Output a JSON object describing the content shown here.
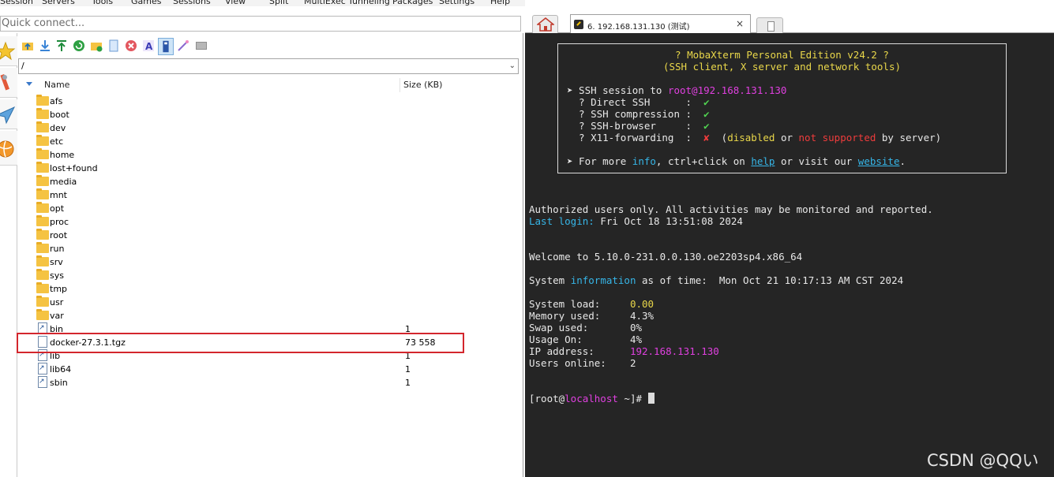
{
  "menubar": {
    "items": [
      "Session",
      "Servers",
      "Tools",
      "Games",
      "Sessions",
      "View",
      "Split",
      "MultiExec",
      "Tunneling",
      "Packages",
      "Settings",
      "Help"
    ]
  },
  "quick_connect": {
    "placeholder": "Quick connect..."
  },
  "sftp": {
    "path": "/",
    "columns": {
      "name": "Name",
      "size": "Size (KB)"
    },
    "files": [
      {
        "name": "afs",
        "type": "folder",
        "size": ""
      },
      {
        "name": "boot",
        "type": "folder",
        "size": ""
      },
      {
        "name": "dev",
        "type": "folder",
        "size": ""
      },
      {
        "name": "etc",
        "type": "folder",
        "size": ""
      },
      {
        "name": "home",
        "type": "folder",
        "size": ""
      },
      {
        "name": "lost+found",
        "type": "folder",
        "size": ""
      },
      {
        "name": "media",
        "type": "folder",
        "size": ""
      },
      {
        "name": "mnt",
        "type": "folder",
        "size": ""
      },
      {
        "name": "opt",
        "type": "folder",
        "size": ""
      },
      {
        "name": "proc",
        "type": "folder",
        "size": ""
      },
      {
        "name": "root",
        "type": "folder",
        "size": ""
      },
      {
        "name": "run",
        "type": "folder",
        "size": ""
      },
      {
        "name": "srv",
        "type": "folder",
        "size": ""
      },
      {
        "name": "sys",
        "type": "folder",
        "size": ""
      },
      {
        "name": "tmp",
        "type": "folder",
        "size": ""
      },
      {
        "name": "usr",
        "type": "folder",
        "size": ""
      },
      {
        "name": "var",
        "type": "folder",
        "size": ""
      },
      {
        "name": "bin",
        "type": "link",
        "size": "1"
      },
      {
        "name": "docker-27.3.1.tgz",
        "type": "file",
        "size": "73 558"
      },
      {
        "name": "lib",
        "type": "link",
        "size": "1"
      },
      {
        "name": "lib64",
        "type": "link",
        "size": "1"
      },
      {
        "name": "sbin",
        "type": "link",
        "size": "1"
      }
    ],
    "highlight_color": "#d3262d"
  },
  "tabs": {
    "session_label": "6. 192.168.131.130 (测试)",
    "close": "×"
  },
  "terminal": {
    "banner": {
      "title": "? MobaXterm Personal Edition v24.2 ?",
      "subtitle": "(SSH client, X server and network tools)",
      "session_prefix": "➤ SSH session to ",
      "session_target": "root@192.168.131.130",
      "direct_ssh": "  ? Direct SSH      :  ",
      "compression": "  ? SSH compression :  ",
      "browser": "  ? SSH-browser     :  ",
      "x11": "  ? X11-forwarding  :  ",
      "check": "✔",
      "cross": "✘",
      "x11_note_1": "  (",
      "x11_disabled": "disabled",
      "x11_or": " or ",
      "x11_not_supported": "not supported",
      "x11_note_2": " by server)",
      "more_1": "➤ For more ",
      "more_info": "info",
      "more_2": ", ctrl+click on ",
      "more_help": "help",
      "more_3": " or visit our ",
      "more_website": "website",
      "more_4": "."
    },
    "authorized": "Authorized users only. All activities may be monitored and reported.",
    "last_login_label": "Last login:",
    "last_login_value": " Fri Oct 18 13:51:08 2024",
    "welcome": "Welcome to 5.10.0-231.0.0.130.oe2203sp4.x86_64",
    "sysinfo_1": "System ",
    "sysinfo_word": "information",
    "sysinfo_2": " as of time:  Mon Oct 21 10:17:13 AM CST 2024",
    "stats": [
      {
        "label": "System load:     ",
        "value": "0.00",
        "color": "yellow"
      },
      {
        "label": "Memory used:     ",
        "value": "4.3%",
        "color": "plain"
      },
      {
        "label": "Swap used:       ",
        "value": "0%",
        "color": "plain"
      },
      {
        "label": "Usage On:        ",
        "value": "4%",
        "color": "plain"
      },
      {
        "label": "IP address:      ",
        "value": "192.168.131.130",
        "color": "mag"
      },
      {
        "label": "Users online:    ",
        "value": "2",
        "color": "plain"
      }
    ],
    "prompt_open": "[root@",
    "prompt_host": "localhost",
    "prompt_close": " ~]# "
  },
  "watermark": "CSDN @QQい",
  "colors": {
    "terminal_bg": "#252525",
    "yellow": "#e9d74a",
    "magenta": "#e040e0",
    "cyan": "#36b6e8",
    "green": "#51d351",
    "red": "#ef3c3c"
  }
}
